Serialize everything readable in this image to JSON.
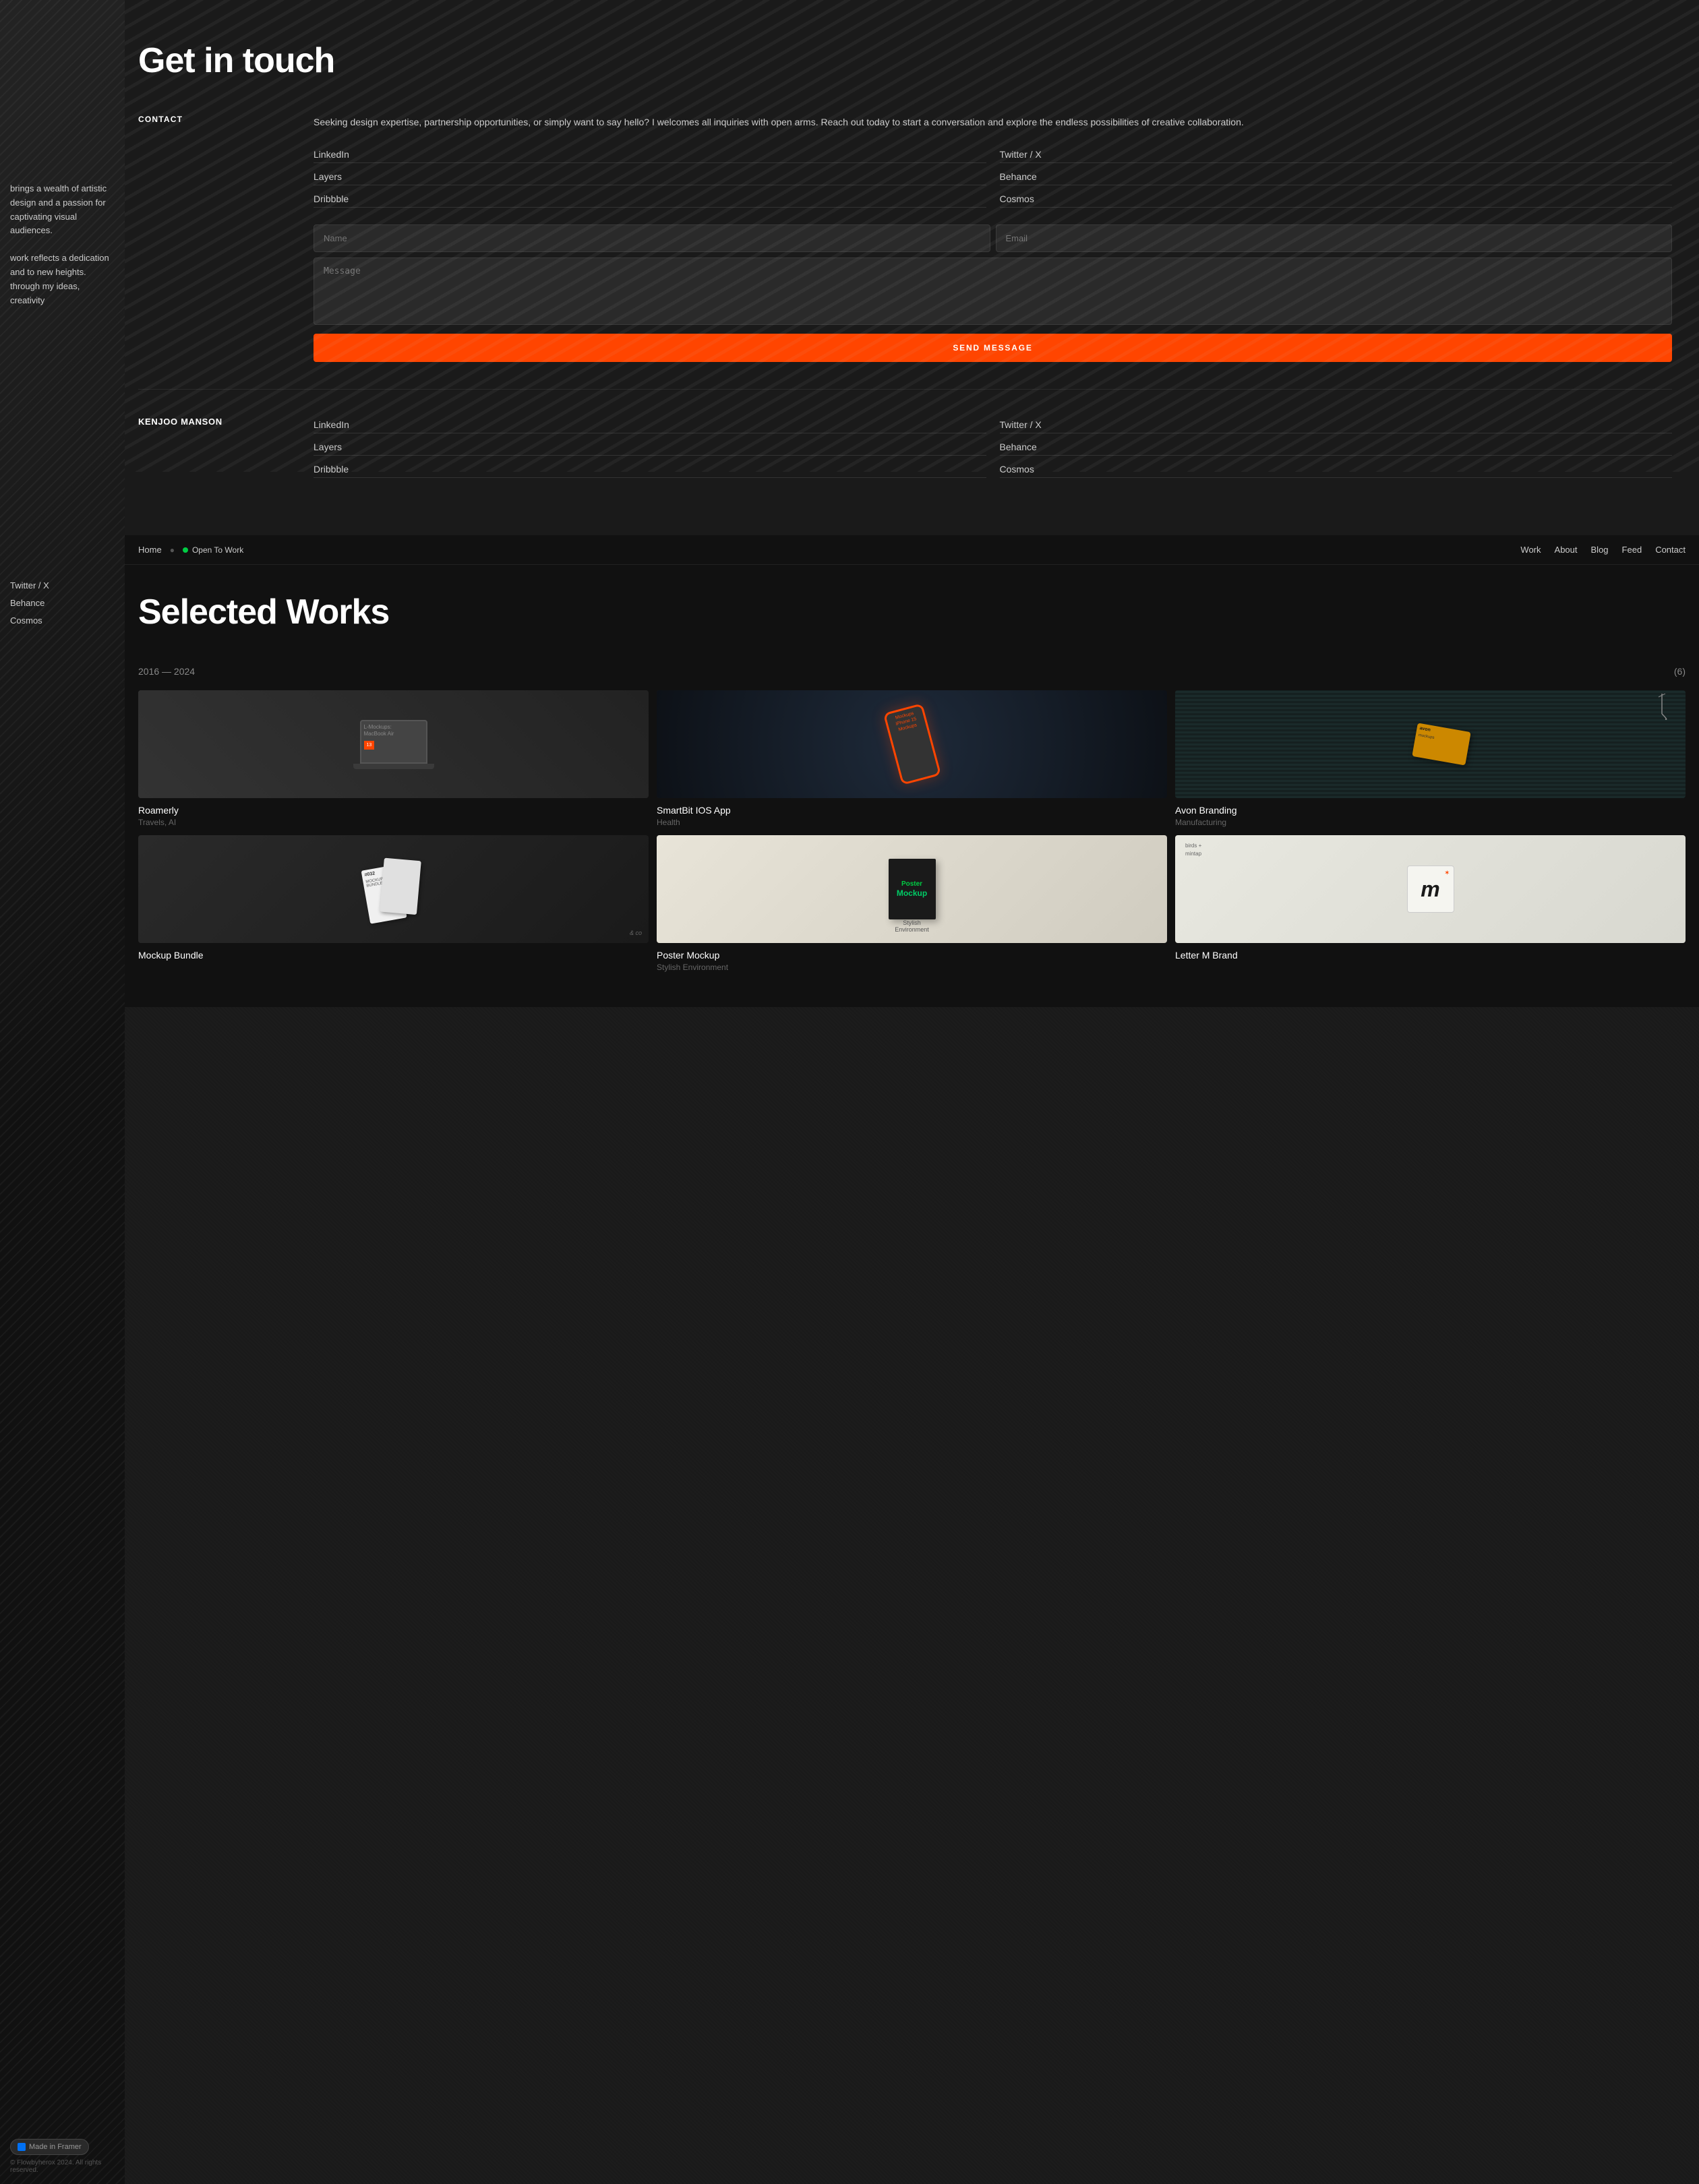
{
  "sidebar": {
    "text_block1": "brings a wealth of artistic design and a passion for captivating visual audiences.",
    "text_block2": "work reflects a dedication and to new heights. through my ideas, creativity",
    "links": {
      "twitter_x": "Twitter / X",
      "behance": "Behance",
      "cosmos": "Cosmos"
    },
    "made_in_framer": "Made in Framer",
    "copyright": "© Flowbyherox 2024. All rights reserved."
  },
  "contact_section": {
    "title": "Get in touch",
    "contact_label": "CONTACT",
    "description": "Seeking design expertise, partnership opportunities, or simply want to say hello? I welcomes all inquiries with open arms. Reach out today to start a conversation and explore the endless possibilities of creative collaboration.",
    "social_links": {
      "linkedin": "LinkedIn",
      "twitter_x": "Twitter / X",
      "layers": "Layers",
      "behance": "Behance",
      "dribbble": "Dribbble",
      "cosmos": "Cosmos"
    },
    "form": {
      "name_placeholder": "Name",
      "email_placeholder": "Email",
      "message_placeholder": "Message",
      "send_button": "SEND MESSAGE"
    },
    "person_name": "KENJOO MANSON",
    "person_links": {
      "linkedin": "LinkedIn",
      "twitter_x": "Twitter / X",
      "layers": "Layers",
      "behance": "Behance",
      "dribbble": "Dribbble",
      "cosmos": "Cosmos"
    }
  },
  "navbar": {
    "home": "Home",
    "status": "Open To Work",
    "links": {
      "work": "Work",
      "about": "About",
      "blog": "Blog",
      "feed": "Feed",
      "contact": "Contact"
    }
  },
  "works_section": {
    "title": "Selected Works",
    "year_range": "2016 — 2024",
    "count": "(6)",
    "projects": [
      {
        "title": "Roamerly",
        "category": "Travels, AI",
        "type": "laptop"
      },
      {
        "title": "SmartBit IOS App",
        "category": "Health",
        "type": "phone"
      },
      {
        "title": "Avon Branding",
        "category": "Manufacturing",
        "type": "card"
      },
      {
        "title": "Mockup Bundle",
        "category": "",
        "type": "bundle"
      },
      {
        "title": "Poster Mockup",
        "category": "Stylish Environment",
        "type": "poster"
      },
      {
        "title": "Letter M Brand",
        "category": "",
        "type": "letter-m"
      }
    ]
  }
}
